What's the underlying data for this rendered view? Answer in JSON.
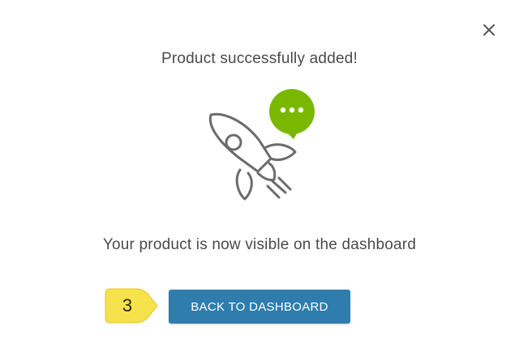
{
  "dialog": {
    "title": "Product successfully added!",
    "message": "Your product is now visible on the dashboard",
    "close_icon": "close-icon",
    "illustration_icons": [
      "rocket-icon",
      "chat-bubble-icon"
    ],
    "primary_button_label": "BACK TO DASHBOARD",
    "step_badge_label": "3"
  },
  "colors": {
    "button_bg": "#2e7dad",
    "chat_bubble": "#7ab800",
    "step_badge": "#f6e24a",
    "text": "#4a4a4a",
    "icon_stroke": "#6b6b6b"
  }
}
